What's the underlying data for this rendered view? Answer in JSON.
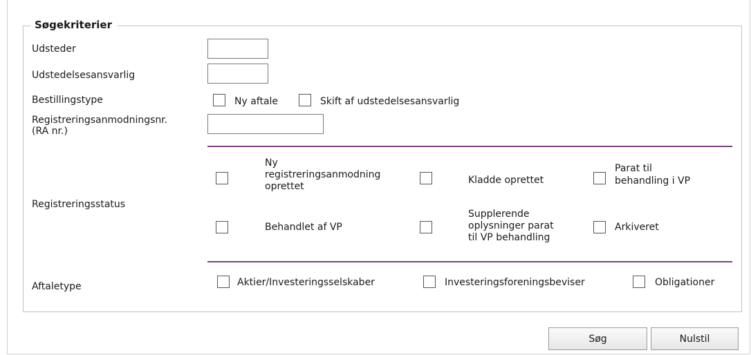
{
  "fieldset": {
    "legend": "Søgekriterier"
  },
  "fields": {
    "udsteder_label": "Udsteder",
    "udsteder_value": "",
    "udstedelsesansvarlig_label": "Udstedelsesansvarlig",
    "udstedelsesansvarlig_value": "",
    "bestillingstype_label": "Bestillingstype",
    "bestillingstype_options": [
      "Ny aftale",
      "Skift af udstedelsesansvarlig"
    ],
    "ra_label_line1": "Registreringsanmodningsnr.",
    "ra_label_line2": "(RA nr.)",
    "ra_value": ""
  },
  "registreringsstatus": {
    "label": "Registreringsstatus",
    "options": [
      {
        "lines": [
          "Ny",
          "registreringsanmodning",
          "oprettet"
        ],
        "checked": false
      },
      {
        "lines": [
          "Kladde oprettet"
        ],
        "checked": false
      },
      {
        "lines": [
          "Parat til",
          "behandling i VP"
        ],
        "checked": false
      },
      {
        "lines": [
          "Behandlet af VP"
        ],
        "checked": false
      },
      {
        "lines": [
          "Supplerende",
          "oplysninger parat",
          "til VP behandling"
        ],
        "checked": false
      },
      {
        "lines": [
          "Arkiveret"
        ],
        "checked": false
      }
    ]
  },
  "aftaletype": {
    "label": "Aftaletype",
    "options": [
      "Aktier/Investeringsselskaber",
      "Investeringsforeningsbeviser",
      "Obligationer"
    ]
  },
  "buttons": {
    "search": "Søg",
    "reset": "Nulstil"
  },
  "colors": {
    "divider": "#7a3f7e",
    "border": "#c0c0c0"
  }
}
